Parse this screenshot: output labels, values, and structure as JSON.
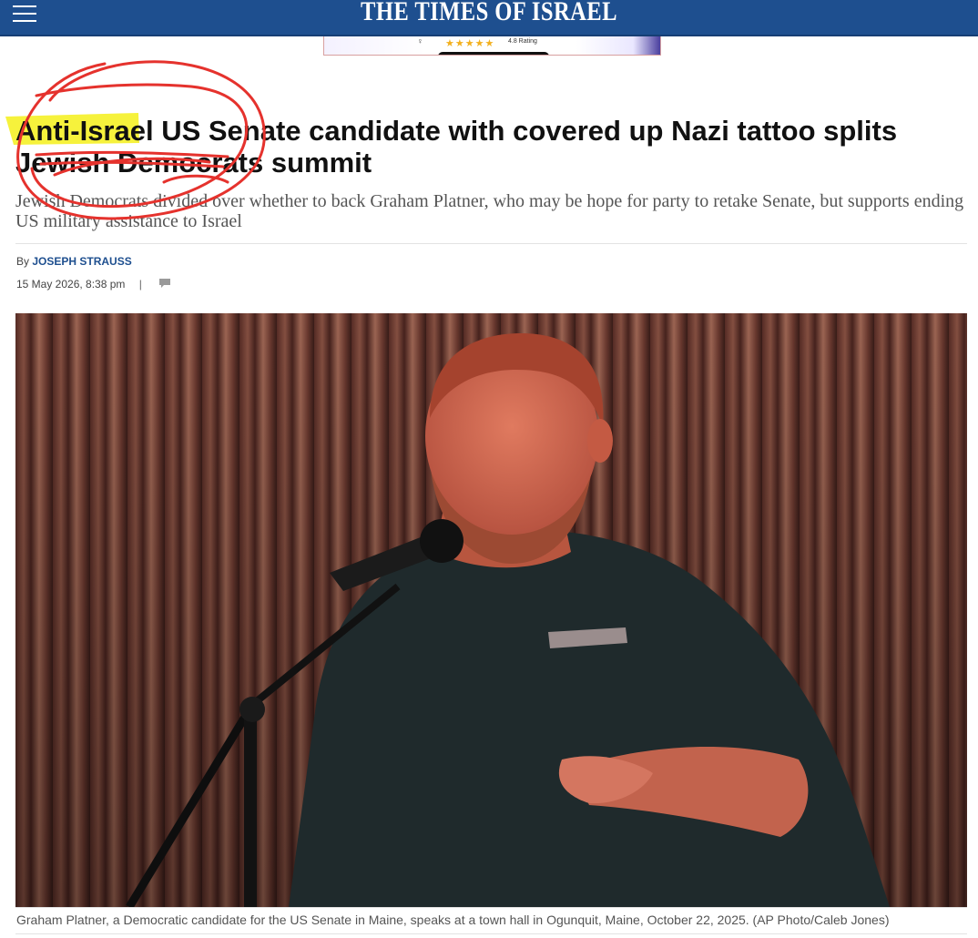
{
  "header": {
    "logo_text": "THE TIMES OF ISRAEL",
    "menu_icon": "hamburger-menu-icon",
    "background_color": "#1e4f8f"
  },
  "ad": {
    "stars": "★★★★★",
    "rating_text": "4.8 Rating"
  },
  "article": {
    "headline": "Anti-Israel US Senate candidate with covered up Nazi tattoo splits Jewish Democrats summit",
    "subhead": "Jewish Democrats divided over whether to back Graham Platner, who may be hope for party to retake Senate, but supports ending US military assistance to Israel",
    "byline_prefix": "By",
    "author": "JOSEPH STRAUSS",
    "date": "15 May 2026, 8:38 pm",
    "separator": "|",
    "comment_icon": "comment-icon",
    "photo_alt": "Graham Platner speaking into a microphone on a stage",
    "caption": "Graham Platner, a Democratic candidate for the US Senate in Maine, speaks at a town hall in Ogunquit, Maine, October 22, 2025. (AP Photo/Caleb Jones)"
  },
  "annotations": {
    "highlight_color": "#f5f01a",
    "scribble_color": "#e5322d"
  }
}
